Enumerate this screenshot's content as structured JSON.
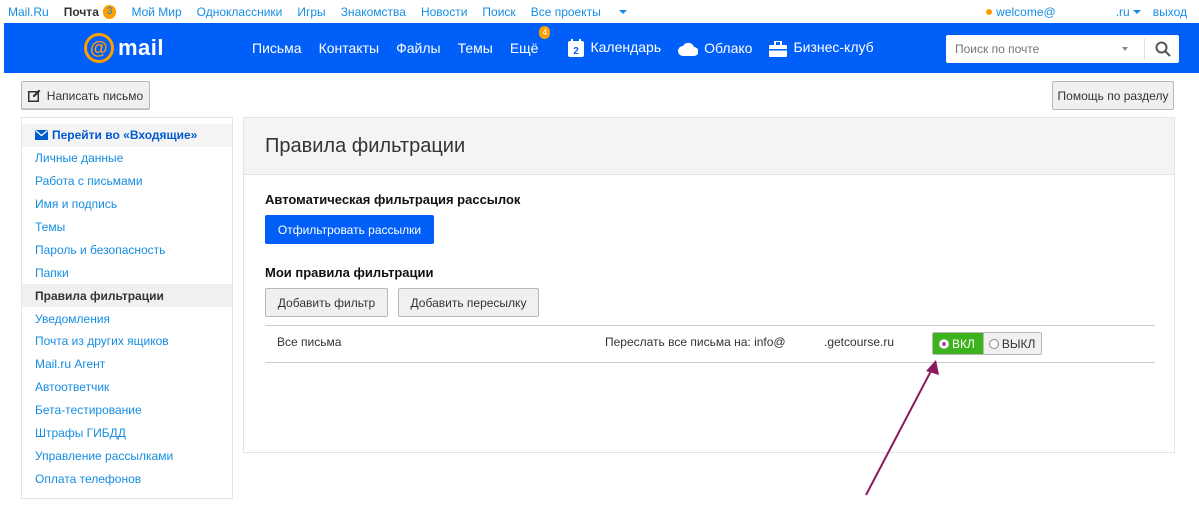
{
  "portal": {
    "items": [
      {
        "label": "Mail.Ru"
      },
      {
        "label": "Почта",
        "count": "3"
      },
      {
        "label": "Мой Мир"
      },
      {
        "label": "Одноклассники"
      },
      {
        "label": "Игры"
      },
      {
        "label": "Знакомства"
      },
      {
        "label": "Новости"
      },
      {
        "label": "Поиск"
      },
      {
        "label": "Все проекты"
      }
    ],
    "user": "welcome@",
    "domain": ".ru",
    "logout": "выход"
  },
  "header": {
    "logo_text": "mail",
    "nav": {
      "letters": "Письма",
      "contacts": "Контакты",
      "files": "Файлы",
      "themes": "Темы",
      "more": "Ещё",
      "more_badge": "4",
      "calendar": "Календарь",
      "calendar_day": "2",
      "cloud": "Облако",
      "business": "Бизнес-клуб"
    },
    "search_placeholder": "Поиск по почте"
  },
  "toolbar": {
    "compose": "Написать письмо",
    "help": "Помощь по разделу"
  },
  "sidebar": {
    "inbox_link": "Перейти во «Входящие»",
    "items": [
      {
        "label": "Личные данные"
      },
      {
        "label": "Работа с письмами"
      },
      {
        "label": "Имя и подпись"
      },
      {
        "label": "Темы"
      },
      {
        "label": "Пароль и безопасность"
      },
      {
        "label": "Папки"
      },
      {
        "label": "Правила фильтрации",
        "active": true
      },
      {
        "label": "Уведомления"
      },
      {
        "label": "Почта из других ящиков"
      },
      {
        "label": "Mail.ru Агент"
      },
      {
        "label": "Автоответчик"
      },
      {
        "label": "Бета-тестирование"
      },
      {
        "label": "Штрафы ГИБДД"
      },
      {
        "label": "Управление рассылками"
      },
      {
        "label": "Оплата телефонов"
      }
    ]
  },
  "main": {
    "title": "Правила фильтрации",
    "auto_section": "Автоматическая фильтрация рассылок",
    "filter_button": "Отфильтровать рассылки",
    "my_rules_section": "Мои правила фильтрации",
    "add_filter": "Добавить фильтр",
    "add_forward": "Добавить пересылку",
    "rule": {
      "name": "Все письма",
      "action": "Переслать все письма на: info@",
      "domain": ".getcourse.ru",
      "on_label": "ВКЛ",
      "off_label": "ВЫКЛ",
      "state": "on"
    }
  },
  "colors": {
    "header_blue": "#005ff9",
    "accent_orange": "#ff9e00",
    "toggle_green": "#3cb21c",
    "annotation_arrow": "#8b1a5c"
  }
}
